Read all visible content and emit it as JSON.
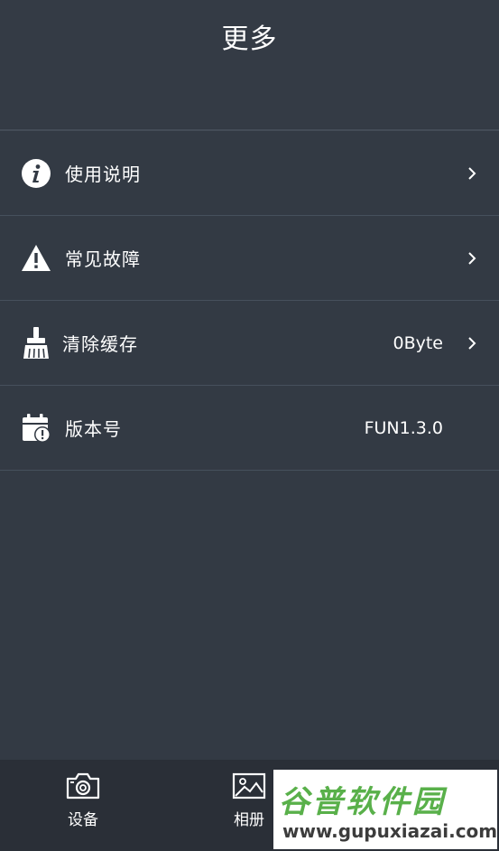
{
  "header": {
    "title": "更多"
  },
  "menu": {
    "items": [
      {
        "label": "使用说明",
        "value": "",
        "icon": "info-icon"
      },
      {
        "label": "常见故障",
        "value": "",
        "icon": "warning-icon"
      },
      {
        "label": "清除缓存",
        "value": "0Byte",
        "icon": "broom-icon"
      },
      {
        "label": "版本号",
        "value": "FUN1.3.0",
        "icon": "calendar-alert-icon"
      }
    ]
  },
  "tabs": [
    {
      "label": "设备",
      "icon": "camera-icon"
    },
    {
      "label": "相册",
      "icon": "image-icon"
    }
  ],
  "watermark": {
    "title": "谷普软件园",
    "url": "www.gupuxiazai.com"
  },
  "colors": {
    "background": "#333a44",
    "bottom_bar": "#2a2f37",
    "divider": "#46505c",
    "watermark_green": "#59b04a"
  }
}
